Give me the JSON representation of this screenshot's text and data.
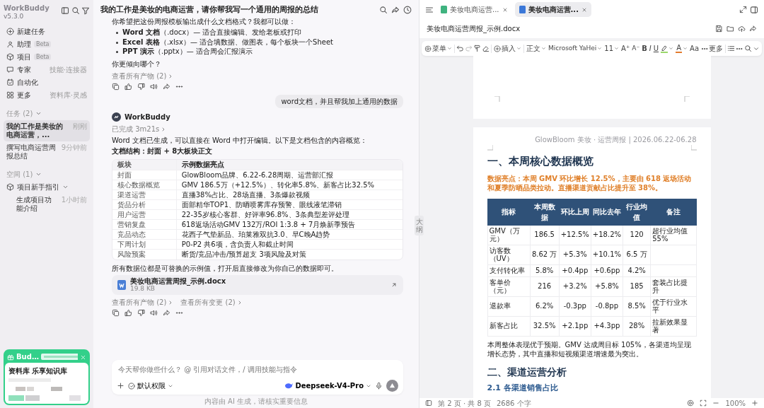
{
  "sidebar": {
    "app_name": "WorkBuddy",
    "version": "v5.3.0",
    "nav": [
      {
        "label": "新建任务"
      },
      {
        "label": "助理",
        "tag": "Beta"
      },
      {
        "label": "项目",
        "tag": "Beta"
      },
      {
        "label": "专家",
        "hint": "技能·连接器"
      },
      {
        "label": "自动化"
      },
      {
        "label": "更多",
        "hint": "资料库·灵感"
      }
    ],
    "tasks_section": {
      "label": "任务 (2)",
      "expanded": true
    },
    "tasks": [
      {
        "title": "我的工作是美妆的电商运营，...",
        "time": "刚刚",
        "selected": true
      },
      {
        "title": "撰写电商运营周报总结",
        "time": "9分钟前",
        "selected": false
      }
    ],
    "spaces_section": {
      "label": "空间 (1)",
      "expanded": true
    },
    "spaces": [
      {
        "name": "项目新手指引",
        "expanded": true,
        "children": [
          {
            "title": "生成项目功能介绍",
            "time": "1小时前"
          }
        ]
      }
    ],
    "popup": {
      "badge": "Bud…",
      "title": "资料库 乐享知识库"
    }
  },
  "chat": {
    "title": "我的工作是美妆的电商运营，请你帮我写一个通用的周报的总结",
    "messages": [
      {
        "kind": "assistant",
        "blocks": [
          {
            "kind": "text",
            "text": "你希望把这份周报模板输出成什么文档格式？我都可以做："
          },
          {
            "kind": "bullets",
            "items": [
              "**Word 文档**（.docx）— 适合直接编辑、发给老板或打印",
              "**Excel 表格**（.xlsx）— 适合填数据、做图表，每个板块一个Sheet",
              "**PPT 演示**（.pptx）— 适合周会汇报演示"
            ]
          },
          {
            "kind": "text",
            "text": "你更倾向哪个？"
          }
        ],
        "links": [
          "查看所有产物 (2)"
        ]
      },
      {
        "kind": "user",
        "text": "word文档，并且帮我加上通用的数据"
      },
      {
        "kind": "assistant",
        "author": "WorkBuddy",
        "status": "已完成 3m21s",
        "blocks": [
          {
            "kind": "text",
            "text": "Word 文档已生成，可以直接在 Word 中打开编辑。以下是文档包含的内容概览："
          },
          {
            "kind": "heading",
            "text": "文档结构：封面 + 8大板块正文"
          },
          {
            "kind": "table",
            "columns": [
              "板块",
              "示例数据亮点"
            ],
            "rows": [
              [
                "封面",
                "GlowBloom品牌、6.22-6.28周期、运营部汇报"
              ],
              [
                "核心数据概览",
                "GMV 186.5万（+12.5%）、转化率5.8%、新客占比32.5%"
              ],
              [
                "渠道运营",
                "直播38%占比、28场直播、3条爆款视频"
              ],
              [
                "货品分析",
                "面部精华TOP1、防晒喷雾库存预警、眼线液笔滞销"
              ],
              [
                "用户运营",
                "22-35岁核心客群、好评率96.8%、3条典型差评处理"
              ],
              [
                "营销复盘",
                "618返场活动GMV 132万/ROI 1:3.8 + 7月焕新季预告"
              ],
              [
                "竞品动态",
                "花西子气垫新品、珀莱雅双抗3.0、早C晚A趋势"
              ],
              [
                "下周计划",
                "P0-P2 共6项，含负责人和截止时间"
              ],
              [
                "风险预案",
                "断货/竞品冲击/预算超支 3项风险及对策"
              ]
            ]
          },
          {
            "kind": "text",
            "text": "所有数据位都是可替换的示例值，打开后直接修改为你自己的数据即可。"
          },
          {
            "kind": "file",
            "name": "美妆电商运营周报_示例.docx",
            "size": "19.8 KB"
          }
        ],
        "links": [
          "查看所有产物 (2)",
          "查看所有变更 (2)"
        ]
      }
    ],
    "composer": {
      "placeholder": "今天帮你做些什么？ @ 引用对话文件，/ 调用技能与指令",
      "permission": "默认权限",
      "model": "Deepseek-V4-Pro"
    },
    "footer": "内容由 AI 生成，请核实重要信息"
  },
  "document": {
    "tabs": [
      {
        "title": "美妆电商运营...",
        "selected": false,
        "color": "#3fb37f"
      },
      {
        "title": "美妆电商运营...",
        "selected": true,
        "color": "#3b78d8"
      }
    ],
    "file_name": "美妆电商运营周报_示例.docx",
    "toolbar": {
      "menu": "菜单",
      "insert": "插入",
      "style": "正文",
      "font": "Microsoft YaHei",
      "size": "11",
      "format": [
        {
          "label": "A⁺",
          "kind": "grow"
        },
        {
          "label": "A⁻",
          "kind": "shrink"
        },
        {
          "label": "B",
          "kind": "bold"
        },
        {
          "label": "I",
          "kind": "italic"
        },
        {
          "label": "U",
          "kind": "underline"
        }
      ],
      "font_color": "A",
      "case": "Aa",
      "more": "更多"
    },
    "outline_tab": "大纲",
    "page_header": "GlowBloom 美妆 · 运营周报 | 2026.06.22-06.28",
    "heading_1": "一、本周核心数据概览",
    "highlight": "数据亮点：本周 GMV 环比增长 12.5%，主要由 618 返场活动和夏季防晒品类拉动。直播渠道贡献占比提升至 38%。",
    "table": {
      "columns": [
        "指标",
        "本周数据",
        "环比上周",
        "同比去年",
        "行业均值",
        "备注"
      ],
      "rows": [
        [
          "GMV（万元）",
          "186.5",
          "+12.5%",
          "+18.2%",
          "120",
          "超行业均值 55%"
        ],
        [
          "访客数（UV）",
          "8.62 万",
          "+5.3%",
          "+10.1%",
          "6.5 万"
        ],
        [
          "支付转化率",
          "5.8%",
          "+0.4pp",
          "+0.6pp",
          "4.2%"
        ],
        [
          "客单价（元）",
          "216",
          "+3.2%",
          "+5.8%",
          "185",
          "套装占比提升"
        ],
        [
          "退款率",
          "6.2%",
          "-0.3pp",
          "-0.8pp",
          "8.5%",
          "优于行业水平"
        ],
        [
          "新客占比",
          "32.5%",
          "+2.1pp",
          "+4.3pp",
          "28%",
          "拉新效果显著"
        ]
      ]
    },
    "summary": "本周整体表现优于预期。GMV 达成周目标 105%，各渠道均呈现增长态势，其中直播和短视频渠道增速最为突出。",
    "heading_2": "二、渠道运营分析",
    "heading_3": "2.1 各渠道销售占比",
    "status": {
      "page": "第 2 页 · 共 8 页",
      "words": "2686 个字",
      "zoom": "100%"
    }
  }
}
